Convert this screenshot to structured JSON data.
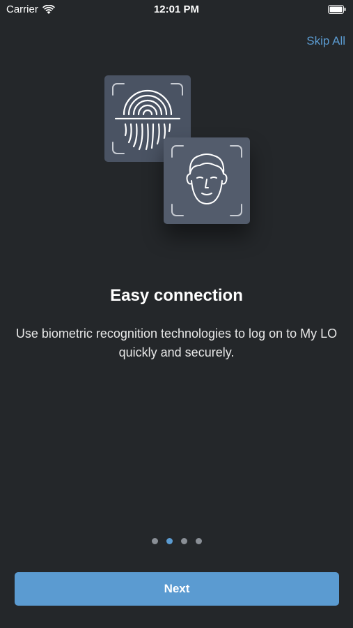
{
  "status_bar": {
    "carrier": "Carrier",
    "time": "12:01 PM"
  },
  "header": {
    "skip_label": "Skip All"
  },
  "onboarding": {
    "title": "Easy connection",
    "description": "Use biometric recognition technologies to log on to My LO quickly and securely.",
    "page_count": 4,
    "active_page": 2
  },
  "footer": {
    "next_label": "Next"
  },
  "colors": {
    "background": "#24272a",
    "accent": "#5b9bd1",
    "card": "#4c5565"
  },
  "icons": [
    "wifi-icon",
    "battery-icon",
    "fingerprint-icon",
    "face-id-icon"
  ]
}
